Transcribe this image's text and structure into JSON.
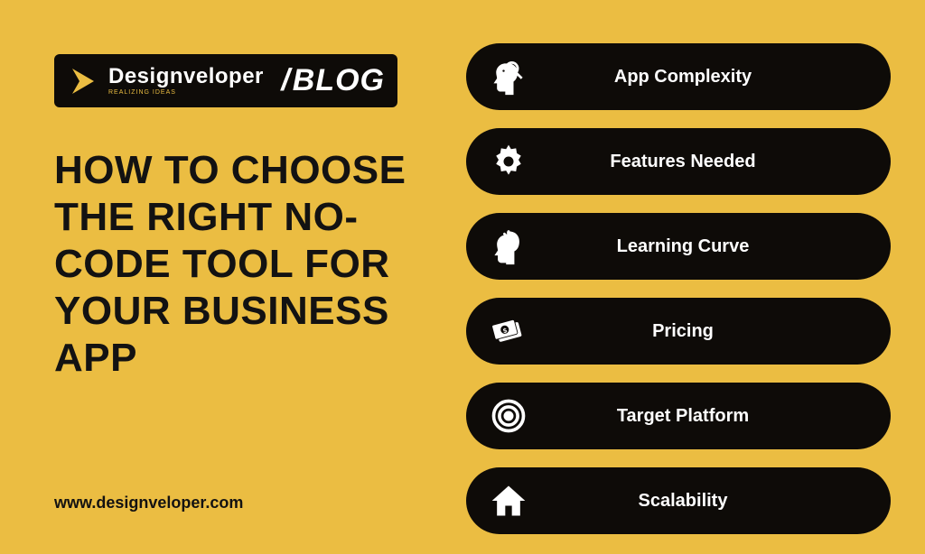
{
  "brand": {
    "name": "Designveloper",
    "tagline": "REALIZING IDEAS",
    "badge": "BLOG"
  },
  "headline": "HOW TO CHOOSE THE RIGHT NO-CODE TOOL FOR YOUR BUSINESS APP",
  "url": "www.designveloper.com",
  "pills": [
    {
      "label": "App Complexity",
      "icon": "head-magnifier-icon"
    },
    {
      "label": "Features Needed",
      "icon": "gear-icon"
    },
    {
      "label": "Learning Curve",
      "icon": "head-arrow-icon"
    },
    {
      "label": "Pricing",
      "icon": "money-icon"
    },
    {
      "label": "Target Platform",
      "icon": "target-icon"
    },
    {
      "label": "Scalability",
      "icon": "house-icon"
    }
  ],
  "colors": {
    "bg": "#ebbd42",
    "pill": "#0e0b08",
    "text": "#131212",
    "white": "#ffffff"
  }
}
